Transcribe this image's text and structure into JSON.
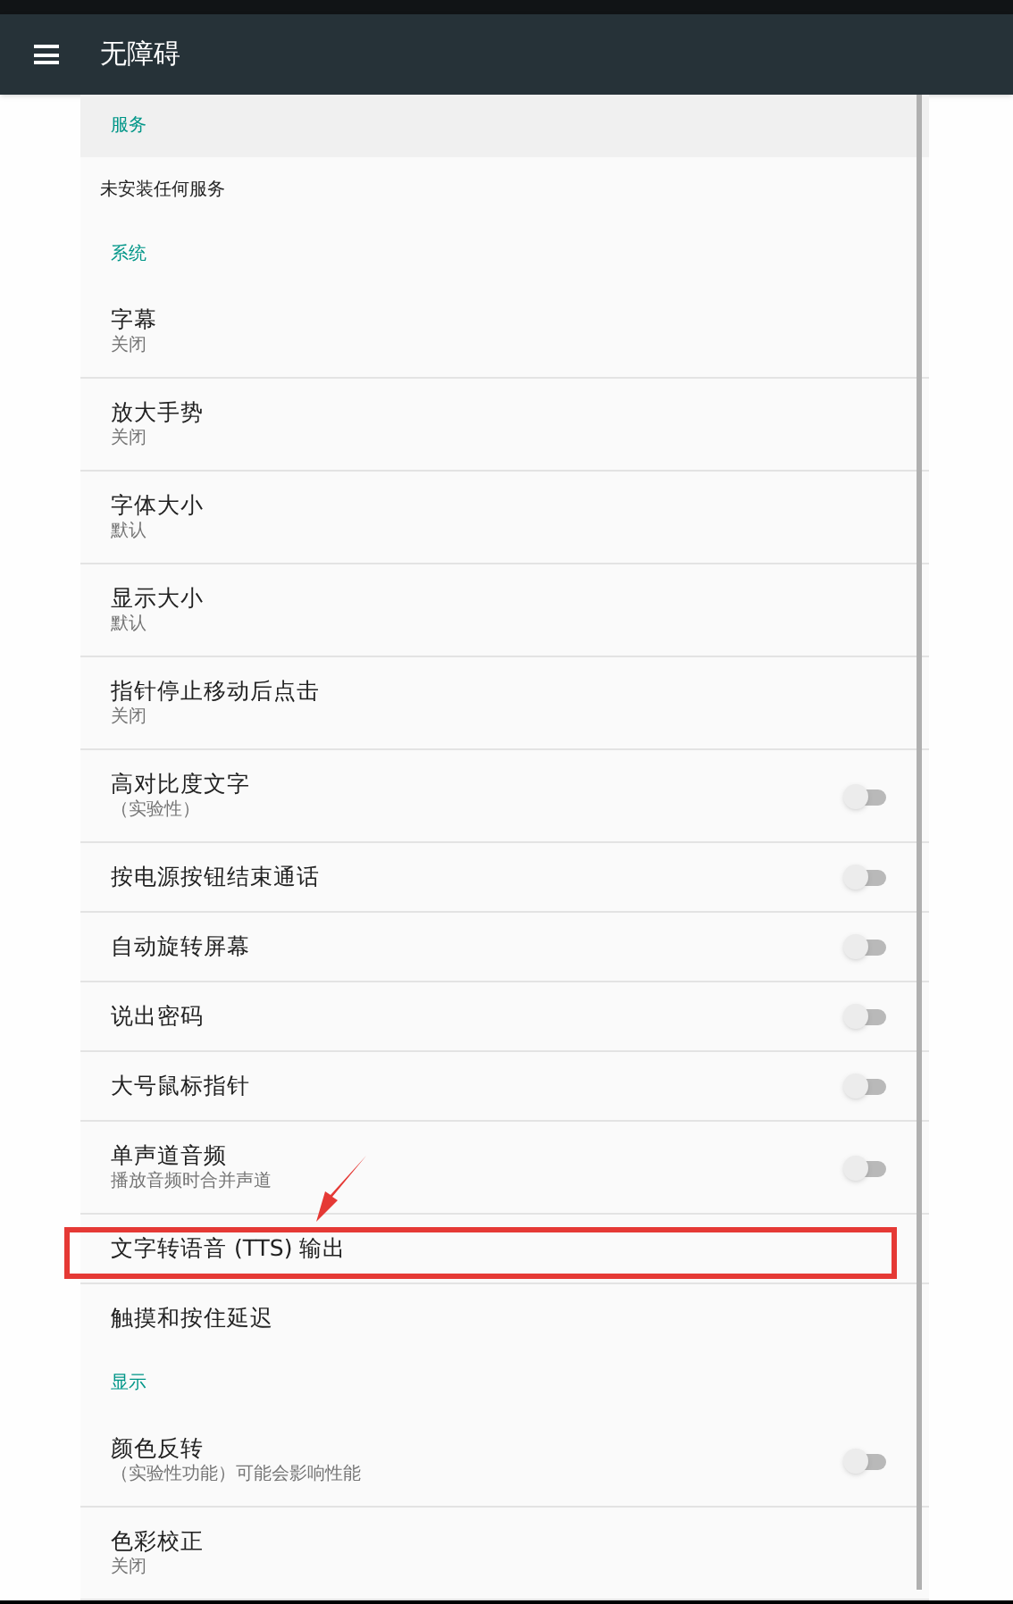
{
  "toolbar": {
    "title": "无障碍"
  },
  "sections": [
    {
      "header": "服务",
      "items": [
        {
          "kind": "message",
          "title": "未安装任何服务"
        }
      ]
    },
    {
      "header": "系统",
      "items": [
        {
          "kind": "plain",
          "title": "字幕",
          "summary": "关闭"
        },
        {
          "kind": "plain",
          "title": "放大手势",
          "summary": "关闭"
        },
        {
          "kind": "plain",
          "title": "字体大小",
          "summary": "默认"
        },
        {
          "kind": "plain",
          "title": "显示大小",
          "summary": "默认"
        },
        {
          "kind": "plain",
          "title": "指针停止移动后点击",
          "summary": "关闭"
        },
        {
          "kind": "toggle",
          "title": "高对比度文字",
          "summary": "（实验性）",
          "on": false
        },
        {
          "kind": "toggle",
          "title": "按电源按钮结束通话",
          "on": false
        },
        {
          "kind": "toggle",
          "title": "自动旋转屏幕",
          "on": false
        },
        {
          "kind": "toggle",
          "title": "说出密码",
          "on": false
        },
        {
          "kind": "toggle",
          "title": "大号鼠标指针",
          "on": false
        },
        {
          "kind": "toggle",
          "title": "单声道音频",
          "summary": "播放音频时合并声道",
          "on": false
        },
        {
          "kind": "plain",
          "title": "文字转语音 (TTS) 输出",
          "highlighted": true
        },
        {
          "kind": "plain",
          "title": "触摸和按住延迟"
        }
      ]
    },
    {
      "header": "显示",
      "items": [
        {
          "kind": "toggle",
          "title": "颜色反转",
          "summary": "（实验性功能）可能会影响性能",
          "on": false
        },
        {
          "kind": "plain",
          "title": "色彩校正",
          "summary": "关闭"
        }
      ]
    }
  ]
}
